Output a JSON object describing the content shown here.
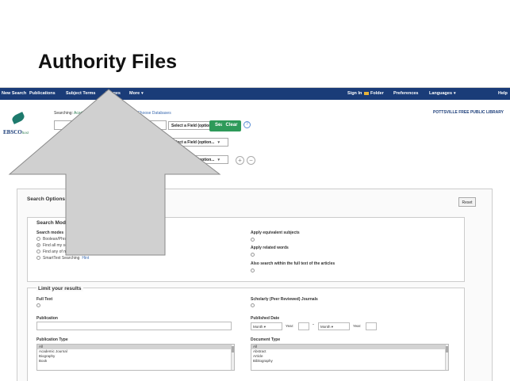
{
  "slide": {
    "title": "Authority Files"
  },
  "topbar": {
    "nav": [
      "New Search",
      "Publications",
      "Subject Terms",
      "Images",
      "More"
    ],
    "right": [
      "Sign In",
      "Folder",
      "Preferences",
      "Languages",
      "Help"
    ]
  },
  "brand": {
    "logo_main": "EBSCO",
    "logo_sub": "host"
  },
  "searching": {
    "prefix": "Searching:",
    "database": "Academic Search Premier Edition",
    "choose": "Choose Databases"
  },
  "search": {
    "field_select": "Select a Field (option...",
    "search_button": "Search",
    "clear_button": "Clear",
    "help": "?"
  },
  "library": {
    "name": "POTTSVILLE FREE PUBLIC LIBRARY"
  },
  "panel": {
    "title": "Search Options",
    "reset": "Reset",
    "modes_header": "Search Modes and Expanders",
    "modes_label": "Search modes",
    "modes": [
      {
        "label": "Boolean/Phrase",
        "selected": false
      },
      {
        "label": "Find all my search terms",
        "selected": true
      },
      {
        "label": "Find any of my search terms",
        "selected": false
      },
      {
        "label": "SmartText Searching",
        "selected": false,
        "hint": "Hint"
      }
    ],
    "expanders": [
      "Apply equivalent subjects",
      "Apply related words",
      "Also search within the full text of the articles"
    ],
    "limit_header": "Limit your results",
    "full_text": "Full Text",
    "scholarly": "Scholarly (Peer Reviewed) Journals",
    "publication": "Publication",
    "published_date": "Published Date",
    "month": "Month",
    "year": "Year:",
    "pub_type_label": "Publication Type",
    "pub_types": [
      "All",
      "Academic Journal",
      "Biography",
      "Book"
    ],
    "doc_type_label": "Document Type",
    "doc_types": [
      "All",
      "Abstract",
      "Article",
      "Bibliography"
    ]
  }
}
